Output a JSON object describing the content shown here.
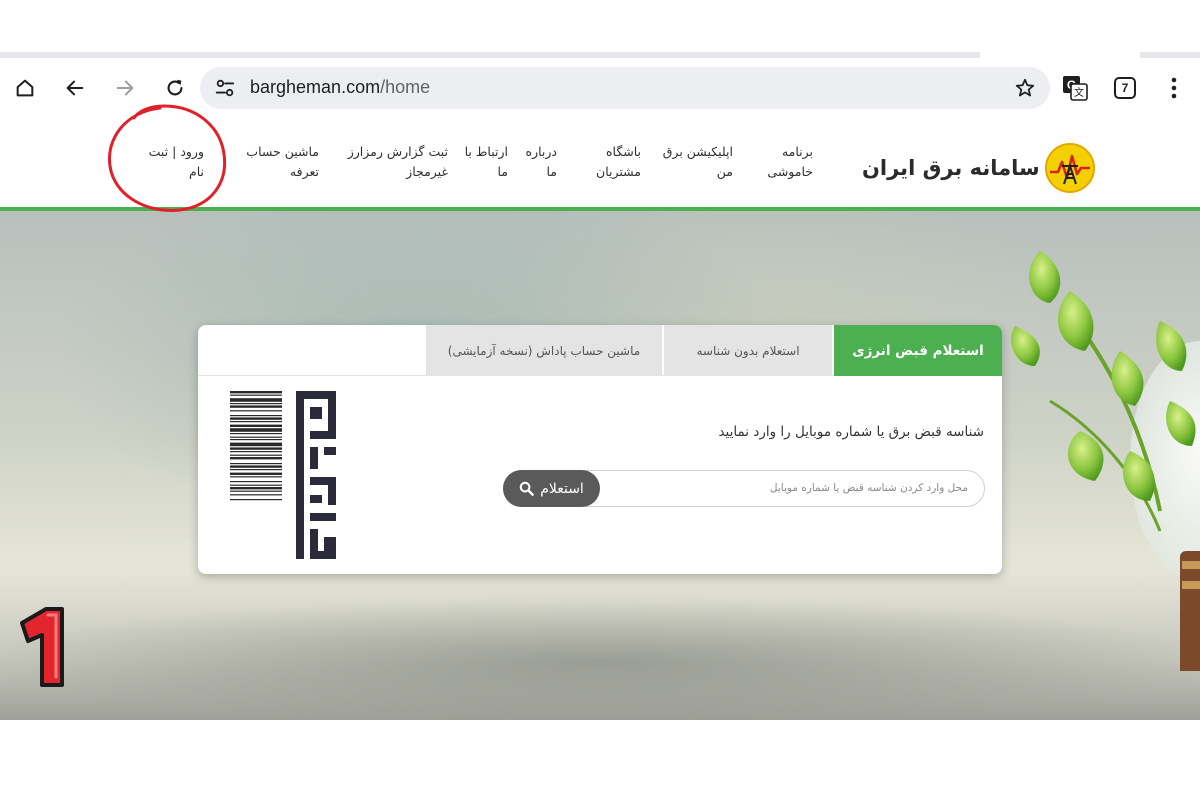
{
  "browser": {
    "url_domain": "bargheman.com",
    "url_path": "/home",
    "tab_count": "7",
    "icons": [
      "home-icon",
      "back-icon",
      "forward-icon",
      "reload-icon",
      "site-info-icon",
      "star-icon",
      "translate-icon",
      "more-icon"
    ]
  },
  "header": {
    "logo_text": "سامانه برق ایران",
    "nav": [
      {
        "line1": "برنامه",
        "line2": "خاموشی"
      },
      {
        "line1": "اپلیکیشن برق",
        "line2": "من"
      },
      {
        "line1": "باشگاه",
        "line2": "مشتریان"
      },
      {
        "line1": "درباره",
        "line2": "ما"
      },
      {
        "line1": "ارتباط با",
        "line2": "ما"
      },
      {
        "line1": "ثبت گزارش رمزارز",
        "line2": "غیرمجاز"
      },
      {
        "line1": "ماشین حساب",
        "line2": "تعرفه"
      },
      {
        "line1": "ورود | ثبت",
        "line2": "نام"
      }
    ],
    "accent_color": "#4caf50"
  },
  "card": {
    "tabs": [
      {
        "label": "استعلام قبض انرژی",
        "active": true
      },
      {
        "label": "استعلام بدون شناسه",
        "active": false
      },
      {
        "label": "ماشین حساب پاداش (نسخه آزمایشی)",
        "active": false
      }
    ],
    "prompt": "شناسه قبض برق یا شماره موبایل را وارد نمایید",
    "search_placeholder": "محل وارد کردن شناسه قبض یا شماره موبایل",
    "search_button": "استعلام",
    "bill_logo_text": "قبض برق"
  },
  "annotation": {
    "step_number": "1",
    "circle_color": "#e0202a"
  }
}
